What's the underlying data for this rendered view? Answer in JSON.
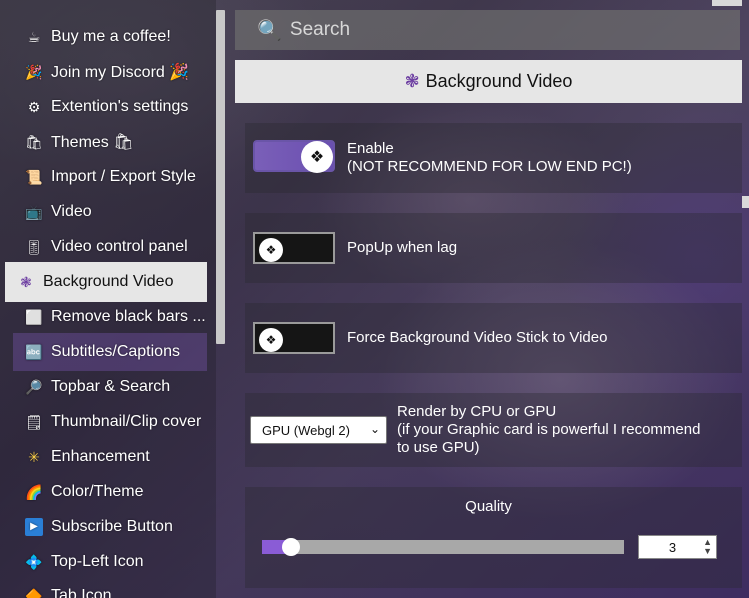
{
  "search": {
    "placeholder": "Search"
  },
  "sidebar": {
    "items": [
      {
        "label": "Buy me a coffee!",
        "icon": "☕",
        "icon_name": "coffee-icon"
      },
      {
        "label": "Join my Discord 🎉",
        "icon": "🎉",
        "icon_name": "party-icon"
      },
      {
        "label": "Extention's settings",
        "icon": "⚙",
        "icon_name": "gear-icon"
      },
      {
        "label": "Themes 🛍",
        "icon": "🛍",
        "icon_name": "shopping-bags-icon"
      },
      {
        "label": "Import / Export Style",
        "icon": "📜",
        "icon_name": "scroll-icon"
      },
      {
        "label": "Video",
        "icon": "📺",
        "icon_name": "tv-icon"
      },
      {
        "label": "Video control panel",
        "icon": "🎚",
        "icon_name": "control-panel-icon"
      },
      {
        "label": "Background Video",
        "icon": "❃",
        "icon_name": "background-video-icon"
      },
      {
        "label": "Remove black bars ...",
        "icon": "⬜",
        "icon_name": "square-icon"
      },
      {
        "label": "Subtitles/Captions",
        "icon": "🔤",
        "icon_name": "captions-icon"
      },
      {
        "label": "Topbar & Search",
        "icon": "🔎",
        "icon_name": "search-icon"
      },
      {
        "label": "Thumbnail/Clip cover",
        "icon": "🗒",
        "icon_name": "notepad-icon"
      },
      {
        "label": "Enhancement",
        "icon": "✳",
        "icon_name": "sparkle-icon"
      },
      {
        "label": "Color/Theme",
        "icon": "🌈",
        "icon_name": "rainbow-icon"
      },
      {
        "label": "Subscribe Button",
        "icon": "▶",
        "icon_name": "play-button-icon"
      },
      {
        "label": "Top-Left Icon",
        "icon": "💠",
        "icon_name": "diamond-icon"
      },
      {
        "label": "Tab Icon",
        "icon": "🔶",
        "icon_name": "tab-icon"
      }
    ]
  },
  "header": {
    "title": "Background Video",
    "icon": "❃"
  },
  "settings": {
    "enable": {
      "label_line1": "Enable",
      "label_line2": "(NOT RECOMMEND FOR LOW END PC!)",
      "on": true
    },
    "popup": {
      "label": "PopUp when lag",
      "on": false
    },
    "force": {
      "label": "Force Background Video Stick to Video",
      "on": false
    },
    "render": {
      "label_line1": "Render by CPU or GPU",
      "label_line2": "(if your Graphic card is powerful I recommend",
      "label_line3": "to use GPU)",
      "selected": "GPU (Webgl 2)"
    },
    "quality": {
      "label": "Quality",
      "value": "3",
      "level": 0.05
    }
  },
  "colors": {
    "accent": "#8a5cd6",
    "panel_header": "#e6e6e6"
  }
}
